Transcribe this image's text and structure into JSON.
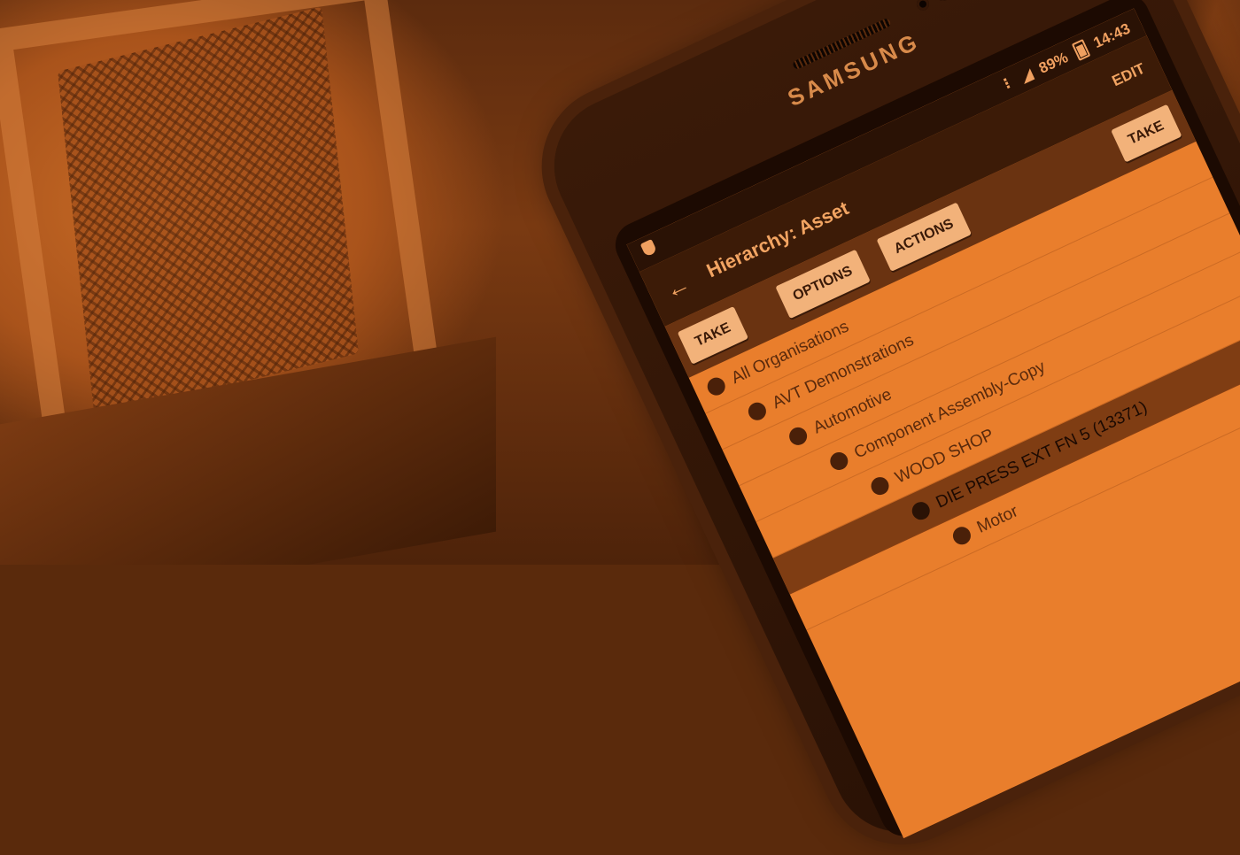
{
  "device": {
    "brand": "SAMSUNG"
  },
  "status_bar": {
    "battery": "89%",
    "time": "14:43",
    "icons": [
      "shield-icon",
      "wifi-icon",
      "signal-icon",
      "battery-icon",
      "kebab-menu-icon"
    ]
  },
  "app_bar": {
    "title": "Hierarchy: Asset",
    "edit_label": "EDIT",
    "back_icon": "back-arrow-icon"
  },
  "toolbar": {
    "take_label": "TAKE",
    "options_label": "OPTIONS",
    "actions_label": "ACTIONS",
    "take_right_label": "TAKE"
  },
  "tree": {
    "items": [
      {
        "label": "All Organisations",
        "level": 0,
        "selected": false
      },
      {
        "label": "AVT Demonstrations",
        "level": 1,
        "selected": false
      },
      {
        "label": "Automotive",
        "level": 2,
        "selected": false
      },
      {
        "label": "Component Assembly-Copy",
        "level": 3,
        "selected": false
      },
      {
        "label": "WOOD SHOP",
        "level": 4,
        "selected": false
      },
      {
        "label": "DIE PRESS EXT FN 5 (13371)",
        "level": 5,
        "selected": true
      },
      {
        "label": "Motor",
        "level": 6,
        "selected": false
      }
    ]
  },
  "colors": {
    "tint": "#e97e2c",
    "dark": "#2a1205",
    "accent": "#f2a462"
  }
}
